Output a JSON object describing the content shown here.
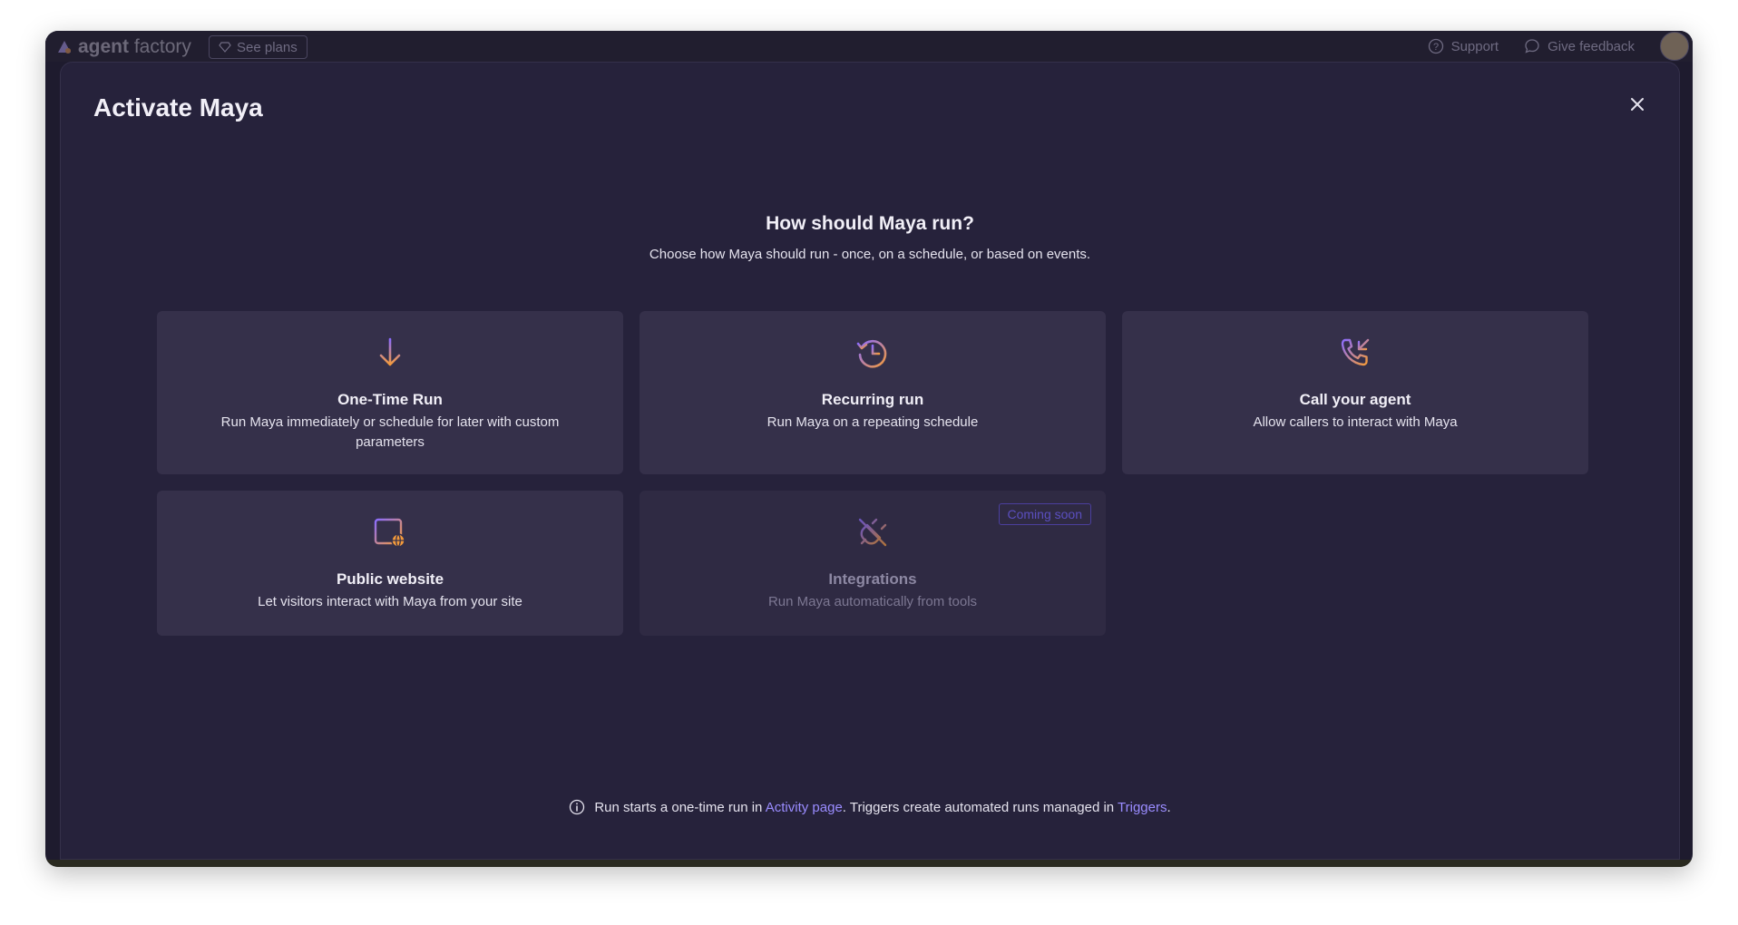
{
  "app": {
    "logo_bold": "agent",
    "logo_light": " factory",
    "see_plans": "See plans",
    "support": "Support",
    "give_feedback": "Give feedback"
  },
  "modal": {
    "title": "Activate Maya",
    "question": "How should Maya run?",
    "subtitle": "Choose how Maya should run - once, on a schedule, or based on events."
  },
  "cards": [
    {
      "title": "One-Time Run",
      "description": "Run Maya immediately or schedule for later with custom parameters",
      "icon": "arrow-down-icon"
    },
    {
      "title": "Recurring run",
      "description": "Run Maya on a repeating schedule",
      "icon": "recurring-clock-icon"
    },
    {
      "title": "Call your agent",
      "description": "Allow callers to interact with Maya",
      "icon": "phone-incoming-icon"
    },
    {
      "title": "Public website",
      "description": "Let visitors interact with Maya from your site",
      "icon": "website-globe-icon"
    },
    {
      "title": "Integrations",
      "description": "Run Maya automatically from tools",
      "icon": "plug-off-icon",
      "badge": "Coming soon",
      "disabled": true
    }
  ],
  "footer": {
    "text_before": "Run starts a one-time run in ",
    "activity_link": "Activity page",
    "text_middle": ". Triggers create automated runs managed in ",
    "triggers_link": "Triggers",
    "text_after": "."
  },
  "colors": {
    "modal_bg": "#26223b",
    "card_bg": "#35304a",
    "accent_link": "#9a8cff",
    "icon_gradient_start": "#8b6cff",
    "icon_gradient_end": "#f39a3b"
  }
}
